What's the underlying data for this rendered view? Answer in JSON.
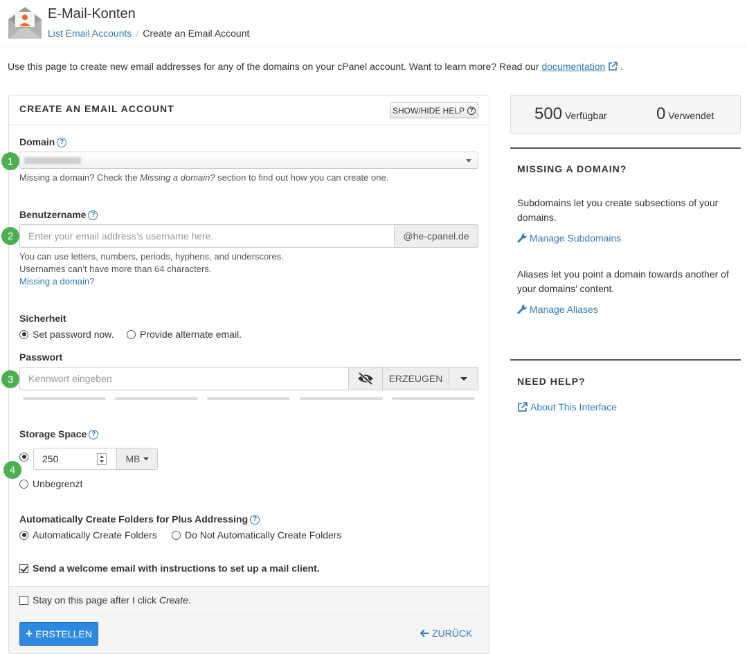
{
  "header": {
    "title": "E-Mail-Konten",
    "breadcrumb_link": "List Email Accounts",
    "breadcrumb_separator": "/",
    "breadcrumb_current": "Create an Email Account"
  },
  "intro": {
    "text": "Use this page to create new email addresses for any of the domains on your cPanel account. Want to learn more? Read our ",
    "link": "documentation",
    "suffix": "."
  },
  "form": {
    "title": "CREATE AN EMAIL ACCOUNT",
    "help_button": "SHOW/HIDE HELP",
    "domain": {
      "step": "1",
      "label": "Domain",
      "hint_pre": "Missing a domain? Check the ",
      "hint_em": "Missing a domain?",
      "hint_post": " section to find out how you can create one."
    },
    "username": {
      "step": "2",
      "label": "Benutzername",
      "placeholder": "Enter your email address’s username here.",
      "suffix": "@he-cpanel.de",
      "hint1": "You can use letters, numbers, periods, hyphens, and underscores.",
      "hint2": "Usernames can’t have more than 64 characters.",
      "missing_link": "Missing a domain?"
    },
    "security": {
      "label": "Sicherheit",
      "option1": "Set password now.",
      "option2": "Provide alternate email.",
      "selected": "Set password now."
    },
    "password": {
      "step": "3",
      "label": "Passwort",
      "placeholder": "Kennwort eingeben",
      "generate": "ERZEUGEN"
    },
    "storage": {
      "step": "4",
      "label": "Storage Space",
      "value": "250",
      "unit": "MB",
      "unlimited": "Unbegrenzt",
      "selected": "250"
    },
    "plus": {
      "label": "Automatically Create Folders for Plus Addressing",
      "option1": "Automatically Create Folders",
      "option2": "Do Not Automatically Create Folders",
      "selected": "Automatically Create Folders"
    },
    "welcome": {
      "label": "Send a welcome email with instructions to set up a mail client.",
      "checked": true
    },
    "stay": {
      "pre": "Stay on this page after I click ",
      "em": "Create",
      "post": ".",
      "checked": false
    },
    "create_button": "ERSTELLEN",
    "back_link": "ZURÜCK"
  },
  "sidebar": {
    "available_count": "500",
    "available_label": "Verfügbar",
    "used_count": "0",
    "used_label": "Verwendet",
    "missing_title": "MISSING A DOMAIN?",
    "subdomains_text": "Subdomains let you create subsections of your domains.",
    "subdomains_link": "Manage Subdomains",
    "aliases_text": "Aliases let you point a domain towards another of your domains’ content.",
    "aliases_link": "Manage Aliases",
    "help_title": "NEED HELP?",
    "about_link": "About This Interface"
  },
  "colors": {
    "link": "#337ab7",
    "step_badge": "#4caf50",
    "primary_button": "#2d8ae0",
    "icon_accent": "#f26522"
  }
}
